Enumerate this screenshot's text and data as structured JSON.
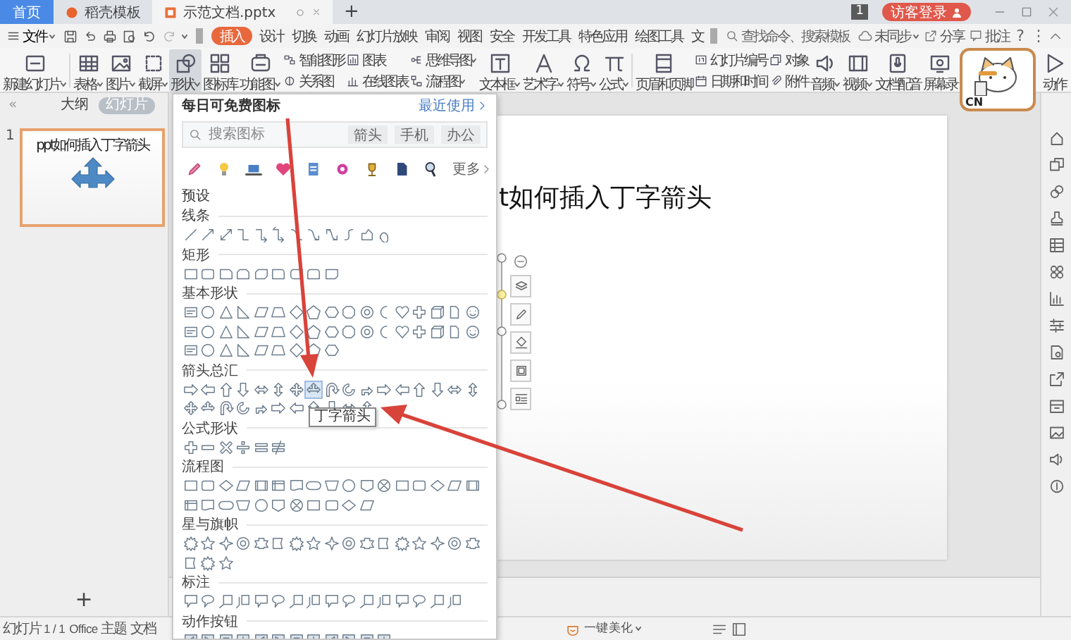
{
  "title_bar": {
    "tabs": [
      {
        "label": "首页",
        "kind": "home",
        "selected": false
      },
      {
        "label": "稻壳模板",
        "kind": "store",
        "selected": false
      },
      {
        "label": "示范文档.pptx",
        "kind": "document",
        "selected": true
      }
    ],
    "new_tab": "+",
    "badge": "1",
    "login": "访客登录"
  },
  "menu_bar": {
    "file": "文件",
    "tabs": [
      {
        "label": "插入",
        "selected": true
      },
      {
        "label": "设计",
        "selected": false
      },
      {
        "label": "切换",
        "selected": false
      },
      {
        "label": "动画",
        "selected": false
      },
      {
        "label": "幻灯片放映",
        "selected": false
      },
      {
        "label": "审阅",
        "selected": false
      },
      {
        "label": "视图",
        "selected": false
      },
      {
        "label": "安全",
        "selected": false
      },
      {
        "label": "开发工具",
        "selected": false
      },
      {
        "label": "特色应用",
        "selected": false
      },
      {
        "label": "绘图工具",
        "selected": false
      },
      {
        "label": "文",
        "selected": false
      }
    ],
    "search": {
      "placeholder": "查找命令、搜索模板"
    },
    "sync": "未同步",
    "share": "分享",
    "comment": "批注",
    "help": "?",
    "more": "⋮"
  },
  "ribbon": {
    "groups": [
      {
        "items": [
          {
            "kind": "large",
            "label": "新建幻灯片",
            "dropdown": true,
            "pressed": false
          }
        ]
      },
      {
        "items": [
          {
            "kind": "large",
            "label": "表格",
            "dropdown": true,
            "pressed": false
          },
          {
            "kind": "large",
            "label": "图片",
            "dropdown": true,
            "pressed": false
          },
          {
            "kind": "large",
            "label": "截屏",
            "dropdown": true,
            "pressed": false
          },
          {
            "kind": "large",
            "label": "形状",
            "dropdown": true,
            "pressed": true
          },
          {
            "kind": "large",
            "label": "图标库",
            "dropdown": false,
            "pressed": false
          },
          {
            "kind": "large",
            "label": "功能图",
            "dropdown": true,
            "pressed": false
          },
          {
            "kind": "stack",
            "pressed": false,
            "rows": [
              {
                "label": "智能图形",
                "dropdown": false
              },
              {
                "label": "关系图",
                "dropdown": false
              }
            ]
          },
          {
            "kind": "stack",
            "pressed": false,
            "rows": [
              {
                "label": "图表",
                "dropdown": false
              },
              {
                "label": "在线图表",
                "dropdown": false
              }
            ]
          },
          {
            "kind": "stack",
            "pressed": false,
            "rows": [
              {
                "label": "思维导图",
                "dropdown": true
              },
              {
                "label": "流程图",
                "dropdown": true
              }
            ]
          },
          {
            "kind": "large",
            "label": "文本框",
            "dropdown": true,
            "pressed": false
          },
          {
            "kind": "large",
            "label": "艺术字",
            "dropdown": true,
            "pressed": false
          },
          {
            "kind": "large",
            "label": "符号",
            "dropdown": true,
            "pressed": false
          },
          {
            "kind": "large",
            "label": "公式",
            "dropdown": true,
            "pressed": false
          }
        ]
      },
      {
        "items": [
          {
            "kind": "large",
            "label": "页眉和页脚",
            "dropdown": false,
            "pressed": false
          },
          {
            "kind": "stack",
            "pressed": false,
            "rows": [
              {
                "label": "幻灯片编号",
                "dropdown": false
              },
              {
                "label": "日期和时间",
                "dropdown": false
              }
            ]
          },
          {
            "kind": "stack",
            "pressed": false,
            "rows": [
              {
                "label": "对象",
                "dropdown": false
              },
              {
                "label": "附件",
                "dropdown": false
              }
            ]
          },
          {
            "kind": "large",
            "label": "音频",
            "dropdown": true,
            "pressed": false
          },
          {
            "kind": "large",
            "label": "视频",
            "dropdown": true,
            "pressed": false
          },
          {
            "kind": "large",
            "label": "文档配音",
            "dropdown": false,
            "pressed": false
          },
          {
            "kind": "large",
            "label": "屏幕录",
            "dropdown": false,
            "pressed": false
          },
          {
            "kind": "large",
            "label": "动作",
            "dropdown": false,
            "pressed": false
          }
        ]
      }
    ]
  },
  "sticker": {
    "text": "CN"
  },
  "left_panel": {
    "collapse": "«",
    "tabs": [
      {
        "label": "大纲",
        "selected": false
      },
      {
        "label": "幻灯片",
        "selected": true
      }
    ],
    "thumbnails": [
      {
        "number": "1",
        "title": "ppt如何插入丁字箭头",
        "selected": true
      }
    ],
    "add": "+"
  },
  "slide": {
    "title": "t如何插入丁字箭头"
  },
  "shapes_panel": {
    "title": "每日可免费图标",
    "recent": "最近使用",
    "search": {
      "placeholder": "搜索图标",
      "tags": [
        "箭头",
        "手机",
        "办公"
      ]
    },
    "more": "更多",
    "preset": "预设",
    "sections": [
      {
        "title": "线条",
        "kind": "lines"
      },
      {
        "title": "矩形",
        "kind": "rects"
      },
      {
        "title": "基本形状",
        "kind": "basic"
      },
      {
        "title": "箭头总汇",
        "kind": "arrows",
        "tooltip": "丁字箭头"
      },
      {
        "title": "公式形状",
        "kind": "math"
      },
      {
        "title": "流程图",
        "kind": "flow"
      },
      {
        "title": "星与旗帜",
        "kind": "stars"
      },
      {
        "title": "标注",
        "kind": "callouts"
      },
      {
        "title": "动作按钮",
        "kind": "action"
      }
    ]
  },
  "status_bar": {
    "slide_info": "幻灯片 1 / 1",
    "theme": "Office 主题",
    "doc": "文档",
    "beautify": "一键美化"
  }
}
